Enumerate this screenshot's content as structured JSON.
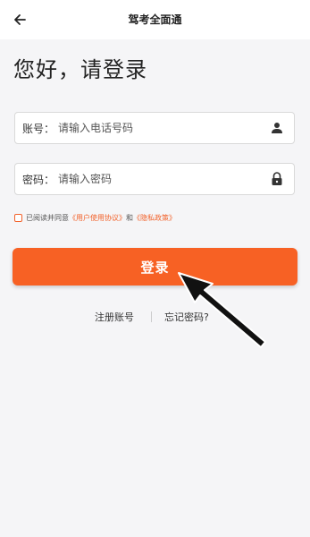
{
  "header": {
    "title": "驾考全面通",
    "back_icon": "arrow-left-icon"
  },
  "greeting": "您好，请登录",
  "account": {
    "label": "账号：",
    "placeholder": "请输入电话号码",
    "icon": "user-icon"
  },
  "password": {
    "label": "密码：",
    "placeholder": "请输入密码",
    "icon": "lock-icon"
  },
  "agreement": {
    "prefix": "已阅读并同意",
    "user_agreement": "《用户使用协议》",
    "and": "和",
    "privacy_policy": "《隐私政策》",
    "checked": false
  },
  "login_button": "登录",
  "links": {
    "register": "注册账号",
    "forgot": "忘记密码?"
  },
  "colors": {
    "accent": "#f76124",
    "link": "#f2622b",
    "background": "#f5f5f7"
  }
}
